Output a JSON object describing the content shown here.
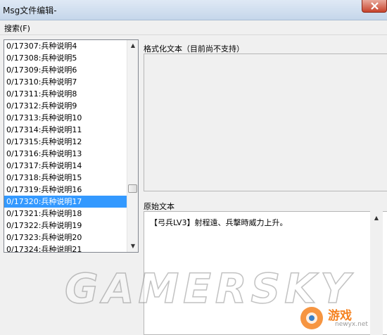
{
  "window": {
    "title": "Msg文件编辑-"
  },
  "menu": {
    "search": "搜索(F)"
  },
  "list": {
    "items": [
      "0/17307:兵种说明4",
      "0/17308:兵种说明5",
      "0/17309:兵种说明6",
      "0/17310:兵种说明7",
      "0/17311:兵种说明8",
      "0/17312:兵种说明9",
      "0/17313:兵种说明10",
      "0/17314:兵种说明11",
      "0/17315:兵种说明12",
      "0/17316:兵种说明13",
      "0/17317:兵种说明14",
      "0/17318:兵种说明15",
      "0/17319:兵种说明16",
      "0/17320:兵种说明17",
      "0/17321:兵种说明18",
      "0/17322:兵种说明19",
      "0/17323:兵种说明20",
      "0/17324:兵种说明21"
    ],
    "selected_index": 13
  },
  "formatted": {
    "label": "格式化文本（目前尚不支持）"
  },
  "original": {
    "label": "原始文本",
    "text": "【弓兵LV3】射程遠、兵擊時威力上升。"
  },
  "watermark": {
    "text": "GAMERSKY",
    "logo_text": "游戏",
    "logo_url": "newyx.net"
  },
  "colors": {
    "selection": "#3399ff",
    "logo_orange": "#f58220"
  }
}
